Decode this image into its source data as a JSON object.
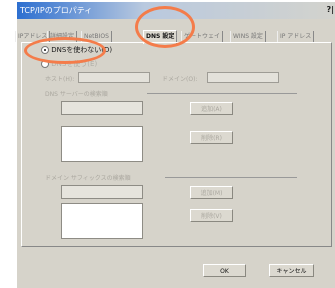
{
  "window": {
    "title": "TCP/IPのプロパティ",
    "help": "?|"
  },
  "tabs": [
    {
      "label": "IPアドレス",
      "active": false
    },
    {
      "label": "詳細設定",
      "active": false
    },
    {
      "label": "NetBIOS",
      "active": false
    },
    {
      "label": "DNS 設定",
      "active": true
    },
    {
      "label": "ゲートウェイ",
      "active": false
    },
    {
      "label": "WINS 設定",
      "active": false
    },
    {
      "label": "IP アドレス",
      "active": false
    }
  ],
  "dns": {
    "disable_label": "DNSを使わない(D)",
    "enable_label": "DNSを使う(E)",
    "host_label": "ホスト(H):",
    "domain_label": "ドメイン(O):",
    "server_group_label": "DNS サーバーの検索順",
    "server_add_button": "追加(A)",
    "server_remove_button": "削除(R)",
    "suffix_group_label": "ドメイン サフィックスの検索順",
    "suffix_add_button": "追加(M)",
    "suffix_remove_button": "削除(V)"
  },
  "footer": {
    "ok_label": "OK",
    "cancel_label": "キャンセル"
  },
  "colors": {
    "highlight_ring": "#f47c4a",
    "title_gradient_start": "#2d6fd0",
    "dialog_face": "#d6d3ca"
  }
}
